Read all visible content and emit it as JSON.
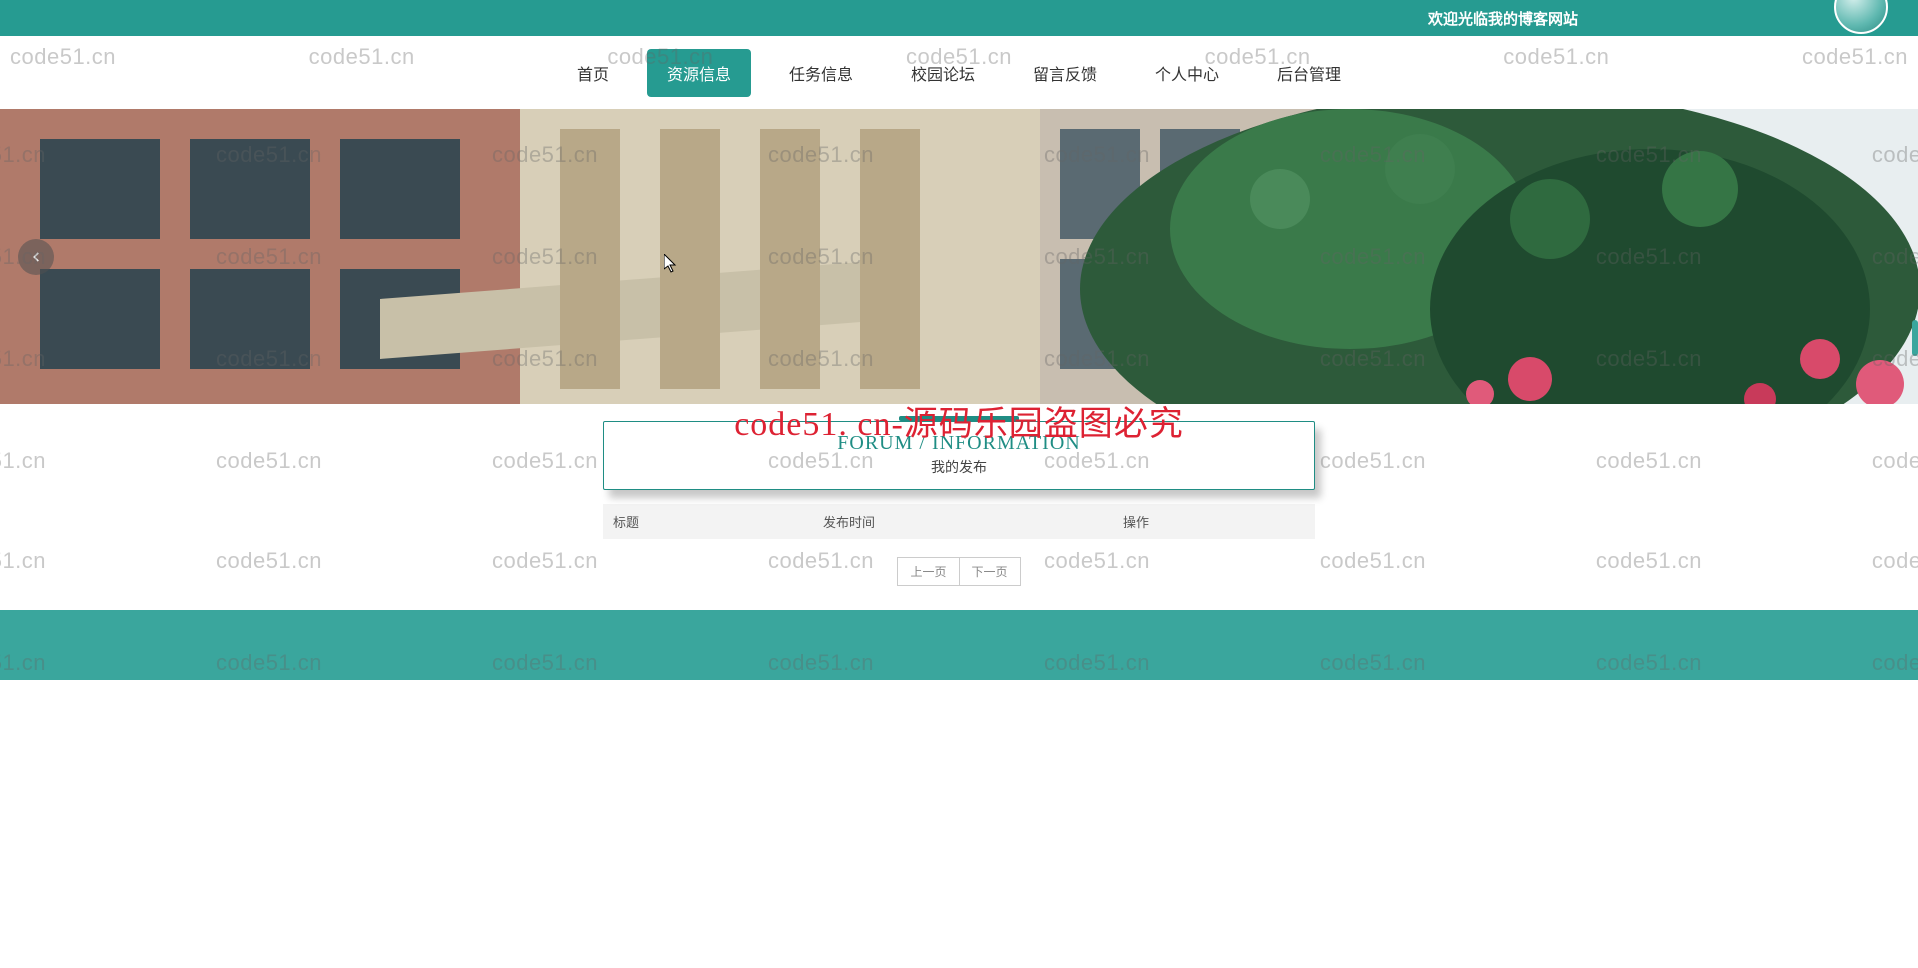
{
  "watermark": "code51.cn",
  "overlay": "code51. cn-源码乐园盗图必究",
  "topbar": {
    "welcome": "欢迎光临我的博客网站"
  },
  "nav": {
    "items": [
      {
        "label": "首页",
        "key": "home"
      },
      {
        "label": "资源信息",
        "key": "resources",
        "active": true
      },
      {
        "label": "任务信息",
        "key": "tasks"
      },
      {
        "label": "校园论坛",
        "key": "forum"
      },
      {
        "label": "留言反馈",
        "key": "feedback"
      },
      {
        "label": "个人中心",
        "key": "profile"
      },
      {
        "label": "后台管理",
        "key": "admin"
      }
    ]
  },
  "panel": {
    "title_en": "FORUM / INFORMATION",
    "title_cn": "我的发布",
    "columns": {
      "title": "标题",
      "time": "发布时间",
      "op": "操作"
    },
    "rows": []
  },
  "pager": {
    "prev": "上一页",
    "next": "下一页"
  }
}
